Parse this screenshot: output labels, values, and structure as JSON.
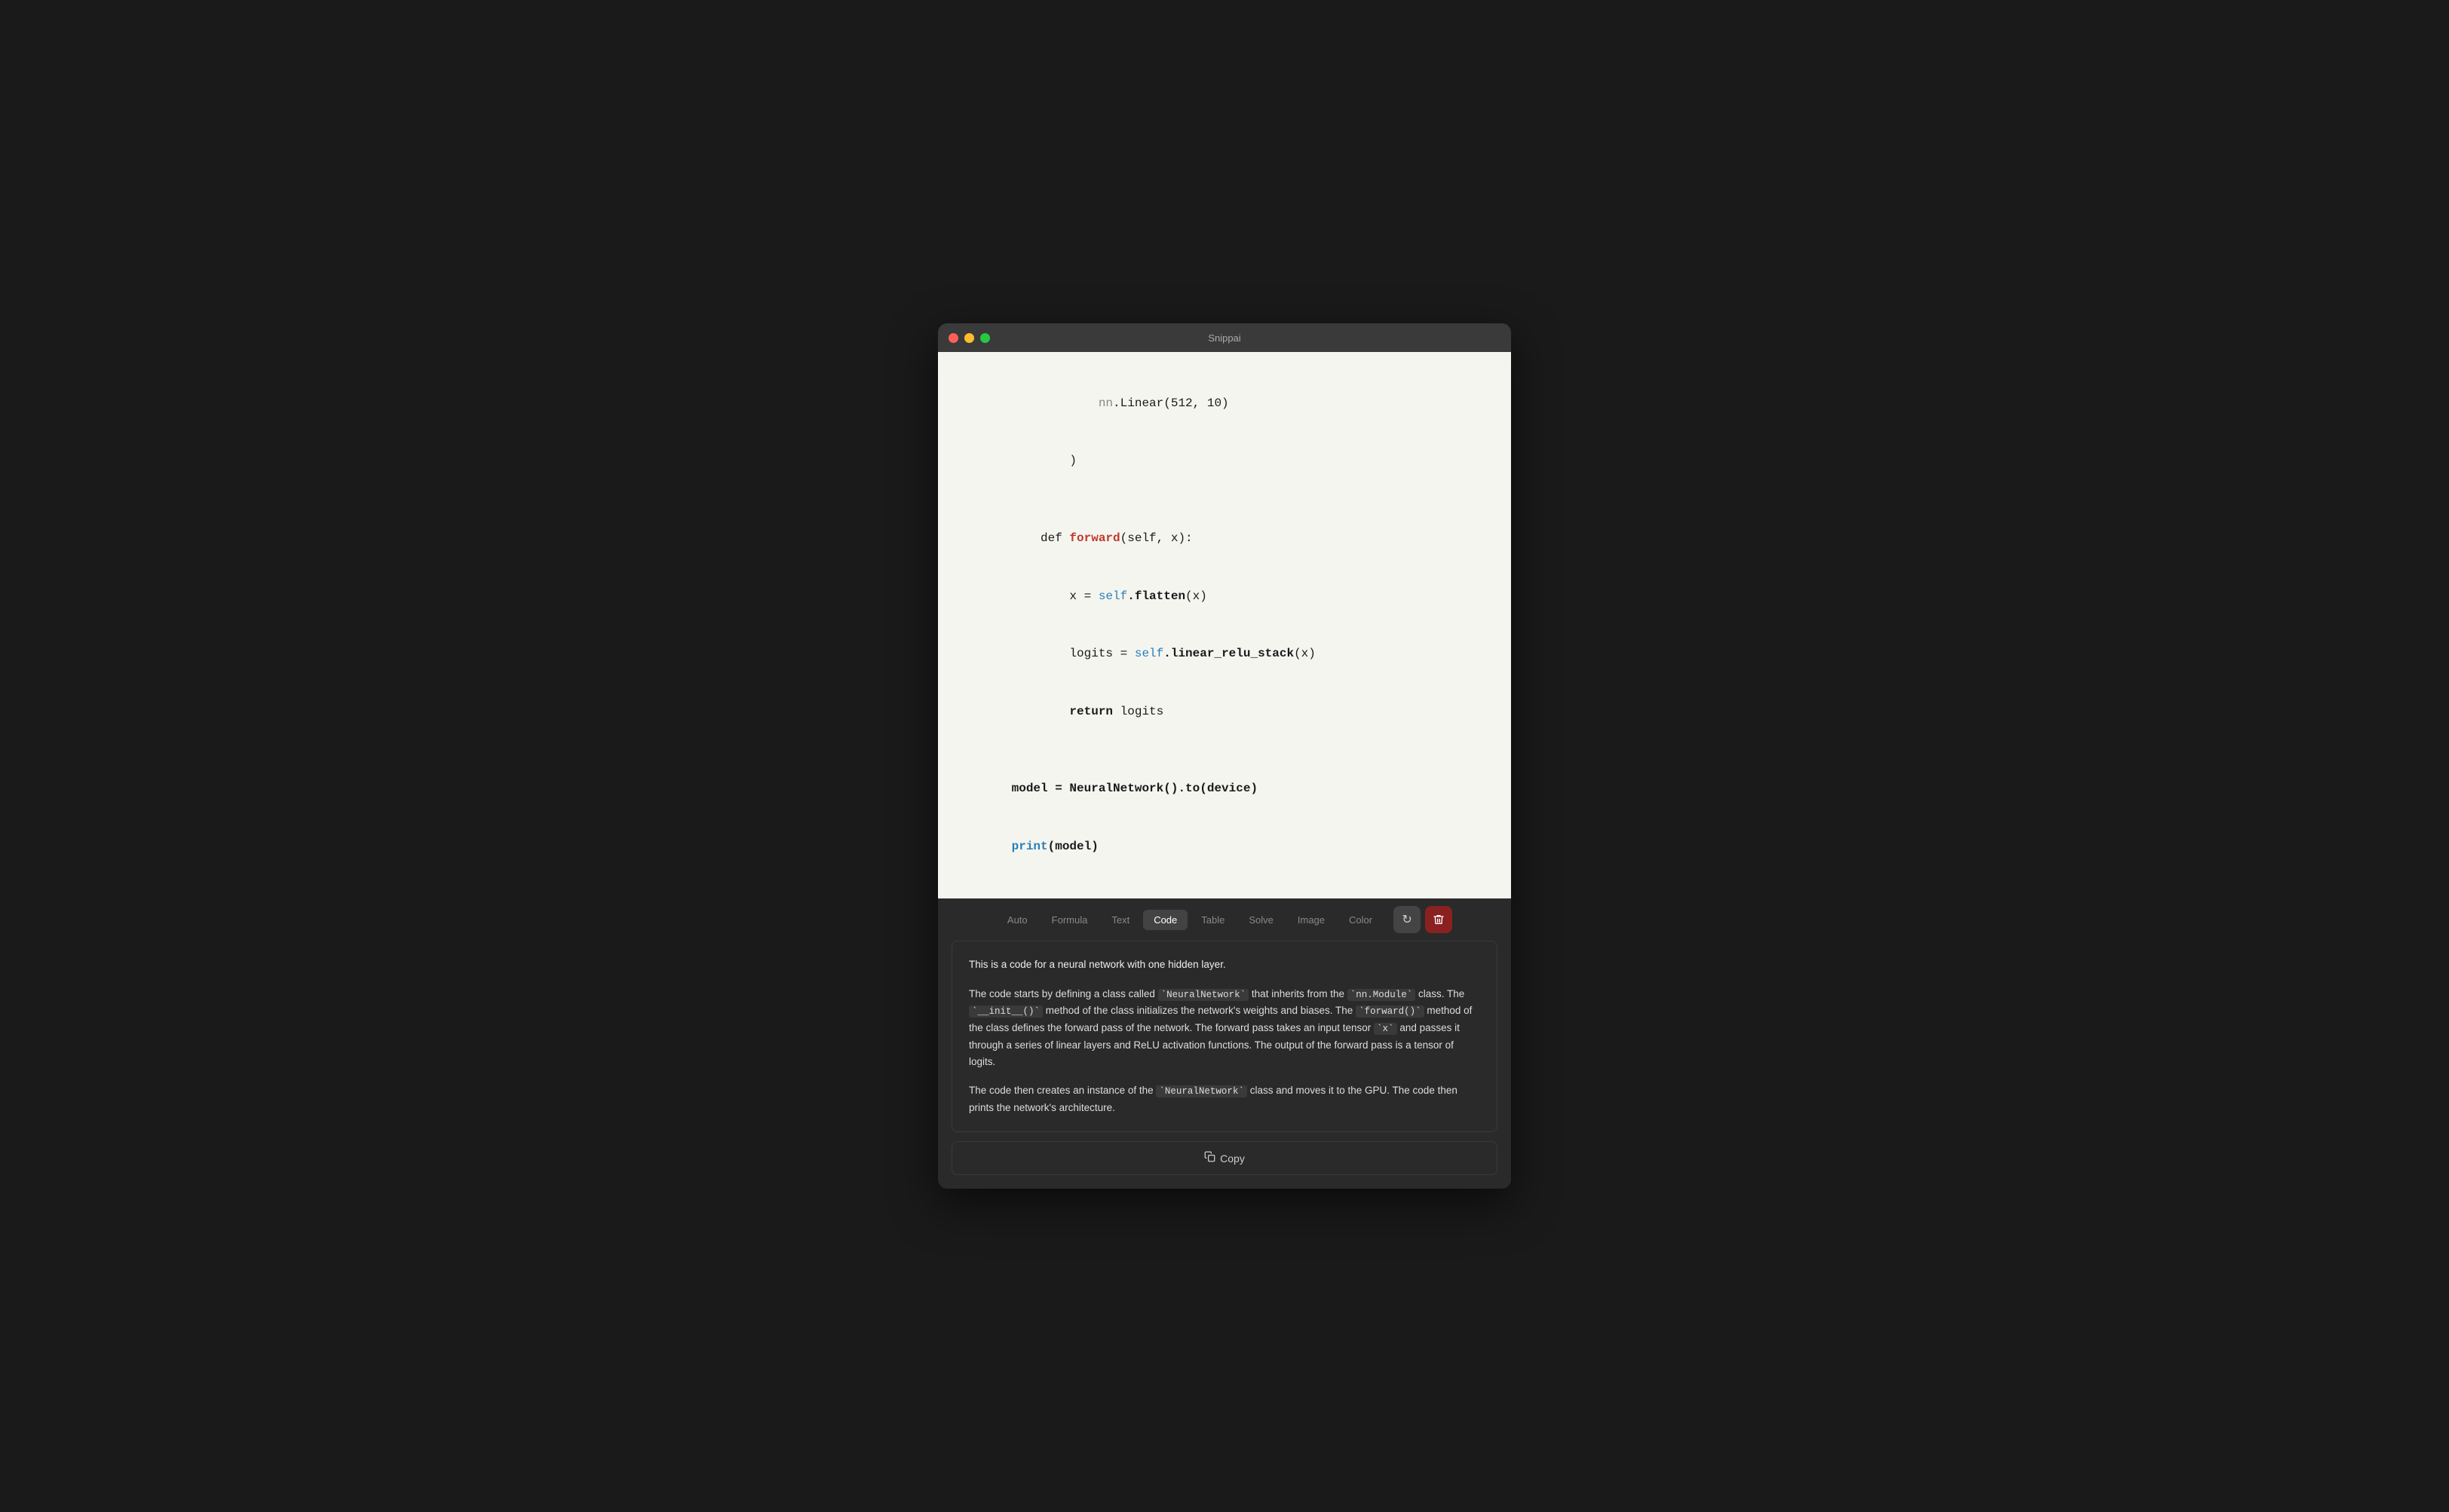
{
  "window": {
    "title": "Snippai"
  },
  "traffic_lights": {
    "close_label": "close",
    "minimize_label": "minimize",
    "maximize_label": "maximize"
  },
  "code": {
    "lines": [
      {
        "indent": 2,
        "content": "nn.Linear(512, 10)"
      },
      {
        "indent": 1,
        "content": ")"
      },
      {
        "indent": 0,
        "content": ""
      },
      {
        "indent": 0,
        "content": "def forward(self, x):"
      },
      {
        "indent": 1,
        "content": "x = self.flatten(x)"
      },
      {
        "indent": 1,
        "content": "logits = self.linear_relu_stack(x)"
      },
      {
        "indent": 1,
        "content": "return logits"
      },
      {
        "indent": 0,
        "content": ""
      },
      {
        "indent": 0,
        "content": "model = NeuralNetwork().to(device)"
      },
      {
        "indent": 0,
        "content": "print(model)"
      }
    ]
  },
  "toolbar": {
    "tabs": [
      {
        "label": "Auto",
        "active": false
      },
      {
        "label": "Formula",
        "active": false
      },
      {
        "label": "Text",
        "active": false
      },
      {
        "label": "Code",
        "active": true
      },
      {
        "label": "Table",
        "active": false
      },
      {
        "label": "Solve",
        "active": false
      },
      {
        "label": "Image",
        "active": false
      },
      {
        "label": "Color",
        "active": false
      }
    ],
    "refresh_icon": "↻",
    "delete_icon": "🗑"
  },
  "description": {
    "title": "This is a code for a neural network with one hidden layer.",
    "paragraphs": [
      "The code starts by defining a class called `NeuralNetwork` that inherits from the `nn.Module` class. The `__init__()` method of the class initializes the network's weights and biases. The `forward()` method of the class defines the forward pass of the network. The forward pass takes an input tensor `x` and passes it through a series of linear layers and ReLU activation functions. The output of the forward pass is a tensor of logits.",
      "The code then creates an instance of the `NeuralNetwork` class and moves it to the GPU. The code then prints the network's architecture."
    ]
  },
  "copy_button": {
    "label": "Copy",
    "icon": "📋"
  }
}
